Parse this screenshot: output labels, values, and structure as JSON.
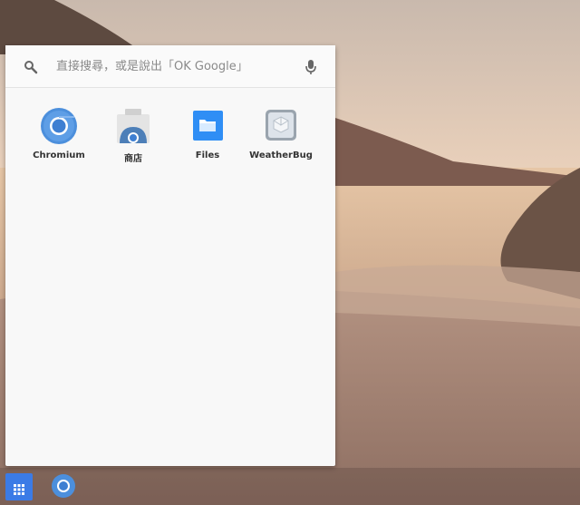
{
  "search": {
    "placeholder": "直接搜尋，或是說出「OK Google」",
    "value": ""
  },
  "apps": [
    {
      "name": "Chromium",
      "icon": "chromium-icon"
    },
    {
      "name": "商店",
      "icon": "store-icon"
    },
    {
      "name": "Files",
      "icon": "files-icon"
    },
    {
      "name": "WeatherBug",
      "icon": "weatherbug-icon"
    }
  ],
  "shelf": {
    "launcher_icon": "apps-grid-icon",
    "pinned": [
      "chromium-icon"
    ]
  },
  "colors": {
    "accent": "#3b7be6",
    "files_blue": "#2f8ef5"
  }
}
